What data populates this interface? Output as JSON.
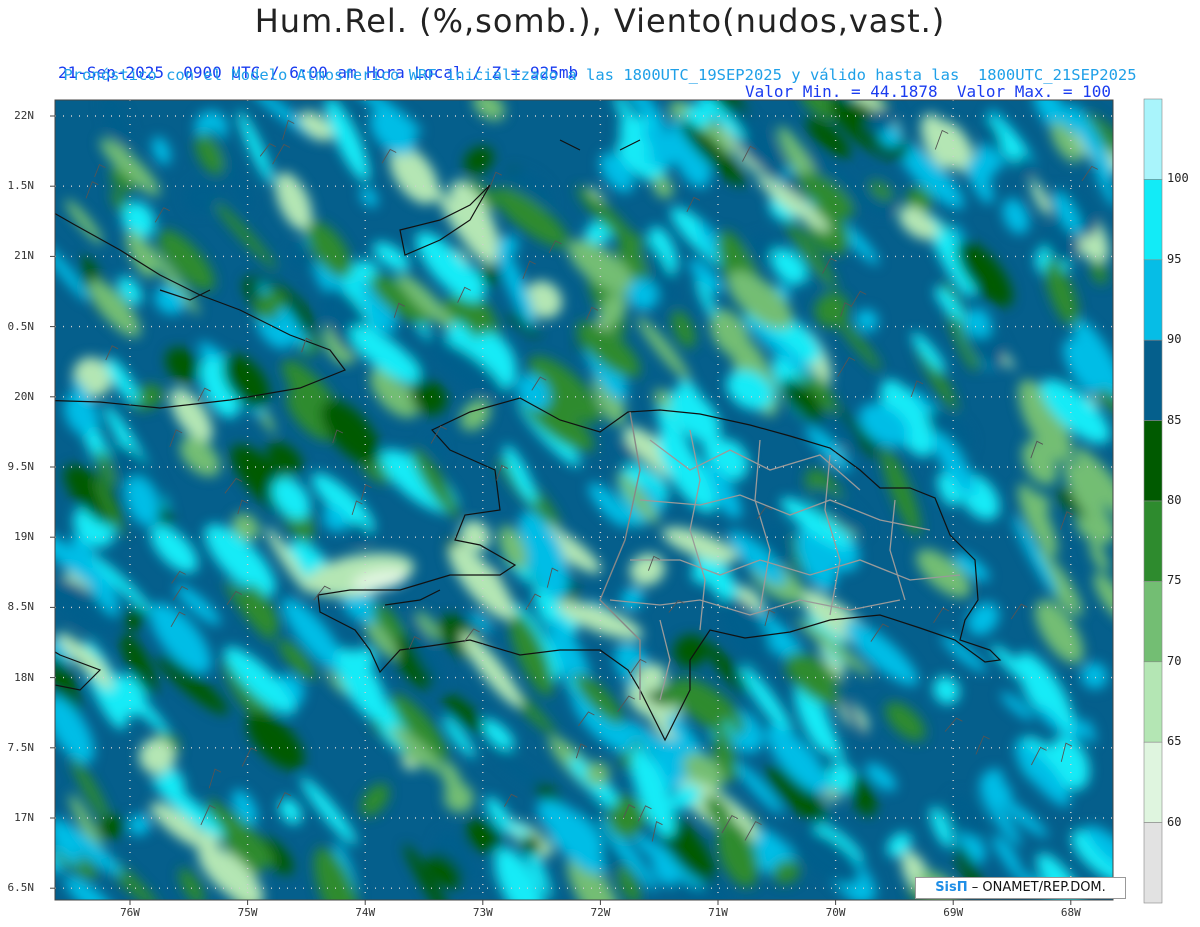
{
  "title": "Hum.Rel. (%,somb.), Viento(nudos,vast.)",
  "header": {
    "line1_left": "21-Sep-2025  0900 UTC / 6:00 am Hora Local / Z = 925mb",
    "line1_right": "Valor Min. = 44.1878  Valor Max. = 100",
    "line2": "Pronóstico con el Modelo Atmosferico WRF inicializado a las 1800UTC_19SEP2025 y válido hasta las  1800UTC_21SEP2025"
  },
  "axes": {
    "y_labels": [
      "22N",
      "1.5N",
      "21N",
      "0.5N",
      "20N",
      "9.5N",
      "19N",
      "8.5N",
      "18N",
      "7.5N",
      "17N",
      "6.5N"
    ],
    "x_labels": [
      "76W",
      "75W",
      "74W",
      "73W",
      "72W",
      "71W",
      "70W",
      "69W",
      "68W"
    ]
  },
  "colorbar": {
    "labels": [
      "100",
      "95",
      "90",
      "85",
      "80",
      "75",
      "70",
      "65",
      "60"
    ],
    "colors": [
      "#a9f4fb",
      "#12ebf7",
      "#06bde6",
      "#055f8c",
      "#005a00",
      "#2e8b2e",
      "#73be73",
      "#b4e6b4",
      "#dff5df",
      "#e2e2e2"
    ]
  },
  "credit": {
    "brand": "SisΠ",
    "text": "– ONAMET/REP.DOM."
  },
  "map_colors": {
    "ocean_deep": "#055f8c",
    "sea_cyan": "#12ebf7",
    "land_border": "#999999",
    "coast": "#111111"
  }
}
